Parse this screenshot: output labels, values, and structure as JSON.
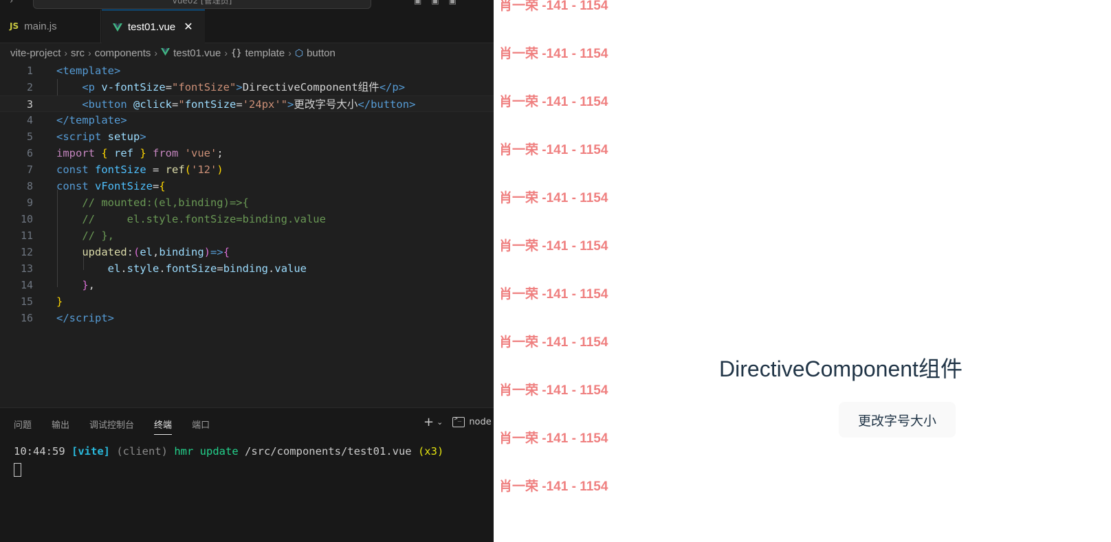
{
  "titlebar": {
    "command_center": "vue02 [管理员]"
  },
  "tabs": [
    {
      "label": "main.js",
      "icon": "js-icon",
      "active": false
    },
    {
      "label": "test01.vue",
      "icon": "vue-icon",
      "active": true,
      "close": "✕"
    }
  ],
  "breadcrumb": {
    "items": [
      "vite-project",
      "src",
      "components",
      "test01.vue",
      "template",
      "button"
    ],
    "template_icon": "{}"
  },
  "code": {
    "line_numbers": [
      "1",
      "2",
      "3",
      "4",
      "5",
      "6",
      "7",
      "8",
      "9",
      "10",
      "11",
      "12",
      "13",
      "14",
      "15",
      "16"
    ],
    "active_line": 3,
    "l1": {
      "open": "<",
      "tag": "template",
      "close": ">"
    },
    "l2": {
      "indent": "    ",
      "open": "<",
      "tag": "p",
      "attr": "v-fontSize",
      "eq": "=",
      "val": "\"fontSize\"",
      "close": ">",
      "text": "DirectiveComponent组件",
      "end_open": "</",
      "end_tag": "p",
      "end_close": ">"
    },
    "l3": {
      "indent": "    ",
      "open": "<",
      "tag": "button",
      "attr": "@click",
      "eq": "=",
      "q1": "\"",
      "expr_var": "fontSize",
      "expr_eq": "=",
      "expr_str": "'24px'",
      "q2": "\"",
      "close": ">",
      "text": "更改字号大小",
      "end_open": "</",
      "end_tag": "button",
      "end_close": ">"
    },
    "l4": {
      "open": "</",
      "tag": "template",
      "close": ">"
    },
    "l5": {
      "open": "<",
      "tag": "script",
      "attr": " setup",
      "close": ">"
    },
    "l6": {
      "kw": "import",
      "b1": " { ",
      "name": "ref",
      "b2": " } ",
      "from": "from",
      "str": " 'vue'",
      "semi": ";"
    },
    "l7": {
      "kw": "const",
      "name": " fontSize",
      "eq": " = ",
      "fn": "ref",
      "p1": "(",
      "str": "'12'",
      "p2": ")"
    },
    "l8": {
      "kw": "const",
      "name": " vFontSize",
      "eq": "=",
      "brace": "{"
    },
    "l9": {
      "indent": "    ",
      "text": "// mounted:(el,binding)=>{"
    },
    "l10": {
      "indent": "    ",
      "text": "//     el.style.fontSize=binding.value"
    },
    "l11": {
      "indent": "    ",
      "text": "// },"
    },
    "l12": {
      "indent": "    ",
      "fn": "updated",
      "colon": ":",
      "p1": "(",
      "a1": "el",
      "comma": ",",
      "a2": "binding",
      "p2": ")",
      "arrow": "=>",
      "brace": "{"
    },
    "l13": {
      "indent": "        ",
      "obj": "el",
      "d1": ".",
      "p1": "style",
      "d2": ".",
      "p2": "fontSize",
      "eq": "=",
      "v1": "binding",
      "d3": ".",
      "v2": "value"
    },
    "l14": {
      "indent": "    ",
      "brace": "}",
      "comma": ","
    },
    "l15": {
      "brace": "}"
    },
    "l16": {
      "open": "</",
      "tag": "script",
      "close": ">"
    }
  },
  "panel": {
    "tabs": [
      "问题",
      "输出",
      "调试控制台",
      "终端",
      "端口"
    ],
    "active_tab": "终端",
    "add_icon": "+",
    "chevron": "⌄",
    "node_label": "node",
    "terminal": {
      "time": "10:44:59 ",
      "vite": "[vite]",
      "client": " (client)",
      "hmr": " hmr update",
      "path": " /src/components/test01.vue",
      "count": " (x3)"
    }
  },
  "preview": {
    "watermark": "肖一荣 -141 - 1154",
    "text": "DirectiveComponent组件",
    "button": "更改字号大小"
  },
  "colors": {
    "editor_bg": "#1f1f1f",
    "accent": "#0078d4",
    "watermark": "#ef7f7f",
    "preview_text": "#213547"
  }
}
